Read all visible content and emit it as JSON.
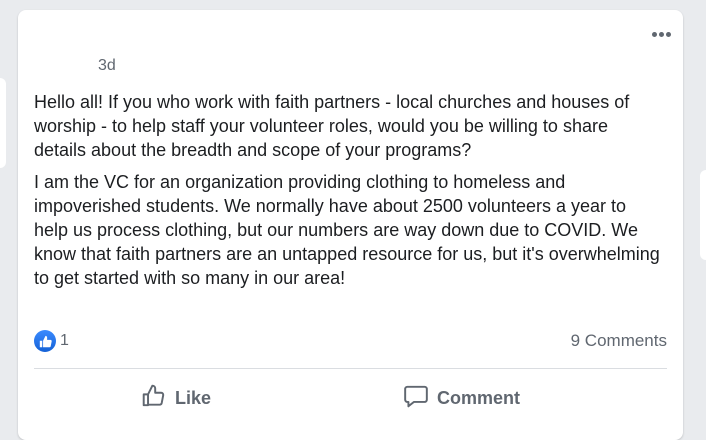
{
  "post": {
    "timestamp": "3d",
    "paragraphs": [
      "Hello all! If you who work with faith partners - local churches and houses of worship - to help staff your volunteer roles, would you be willing to share details about the breadth and scope of your programs?",
      "I am the VC for an organization providing clothing to homeless and impoverished students. We normally have about 2500 volunteers a year to help us process clothing, but our numbers are way down due to COVID. We know that faith partners are an untapped resource for us, but it's overwhelming to get started with so many in our area!"
    ]
  },
  "reactions": {
    "icon": "thumbs-up-icon",
    "count": "1",
    "comments_label": "9 Comments"
  },
  "actions": {
    "like_label": "Like",
    "like_icon": "thumbs-up-outline-icon",
    "comment_label": "Comment",
    "comment_icon": "speech-bubble-icon"
  },
  "colors": {
    "accent": "#1877f2",
    "text": "#1c1e21",
    "secondary_text": "#606770",
    "background": "#e9ebee"
  }
}
